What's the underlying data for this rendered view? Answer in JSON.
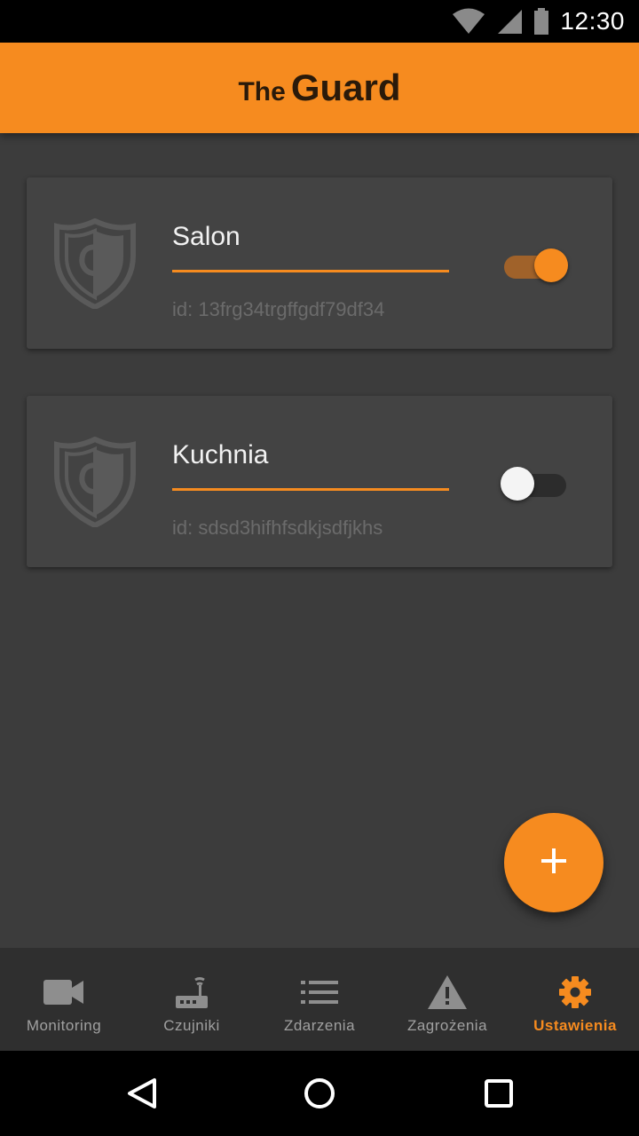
{
  "status_bar": {
    "time": "12:30",
    "icons": [
      "wifi-icon",
      "cellular-signal-icon",
      "battery-icon"
    ]
  },
  "app_bar": {
    "title_prefix": "The",
    "title_main": "Guard"
  },
  "devices": [
    {
      "name": "Salon",
      "id_text": "id: 13frg34trgffgdf79df34",
      "enabled": true,
      "icon": "shield-logo-icon"
    },
    {
      "name": "Kuchnia",
      "id_text": "id: sdsd3hifhfsdkjsdfjkhs",
      "enabled": false,
      "icon": "shield-logo-icon"
    }
  ],
  "fab": {
    "icon": "plus-icon"
  },
  "bottom_nav": {
    "items": [
      {
        "label": "Monitoring",
        "icon": "video-camera-icon",
        "active": false
      },
      {
        "label": "Czujniki",
        "icon": "router-sensor-icon",
        "active": false
      },
      {
        "label": "Zdarzenia",
        "icon": "list-icon",
        "active": false
      },
      {
        "label": "Zagrożenia",
        "icon": "warning-icon",
        "active": false
      },
      {
        "label": "Ustawienia",
        "icon": "gear-icon",
        "active": true
      }
    ]
  },
  "system_nav": {
    "icons": [
      "back-icon",
      "home-icon",
      "recents-icon"
    ]
  },
  "colors": {
    "accent": "#f68b1f",
    "background": "#3c3c3c",
    "card": "#434343",
    "nav_background": "#2f2f2f",
    "inactive_nav": "#a0a0a0"
  }
}
